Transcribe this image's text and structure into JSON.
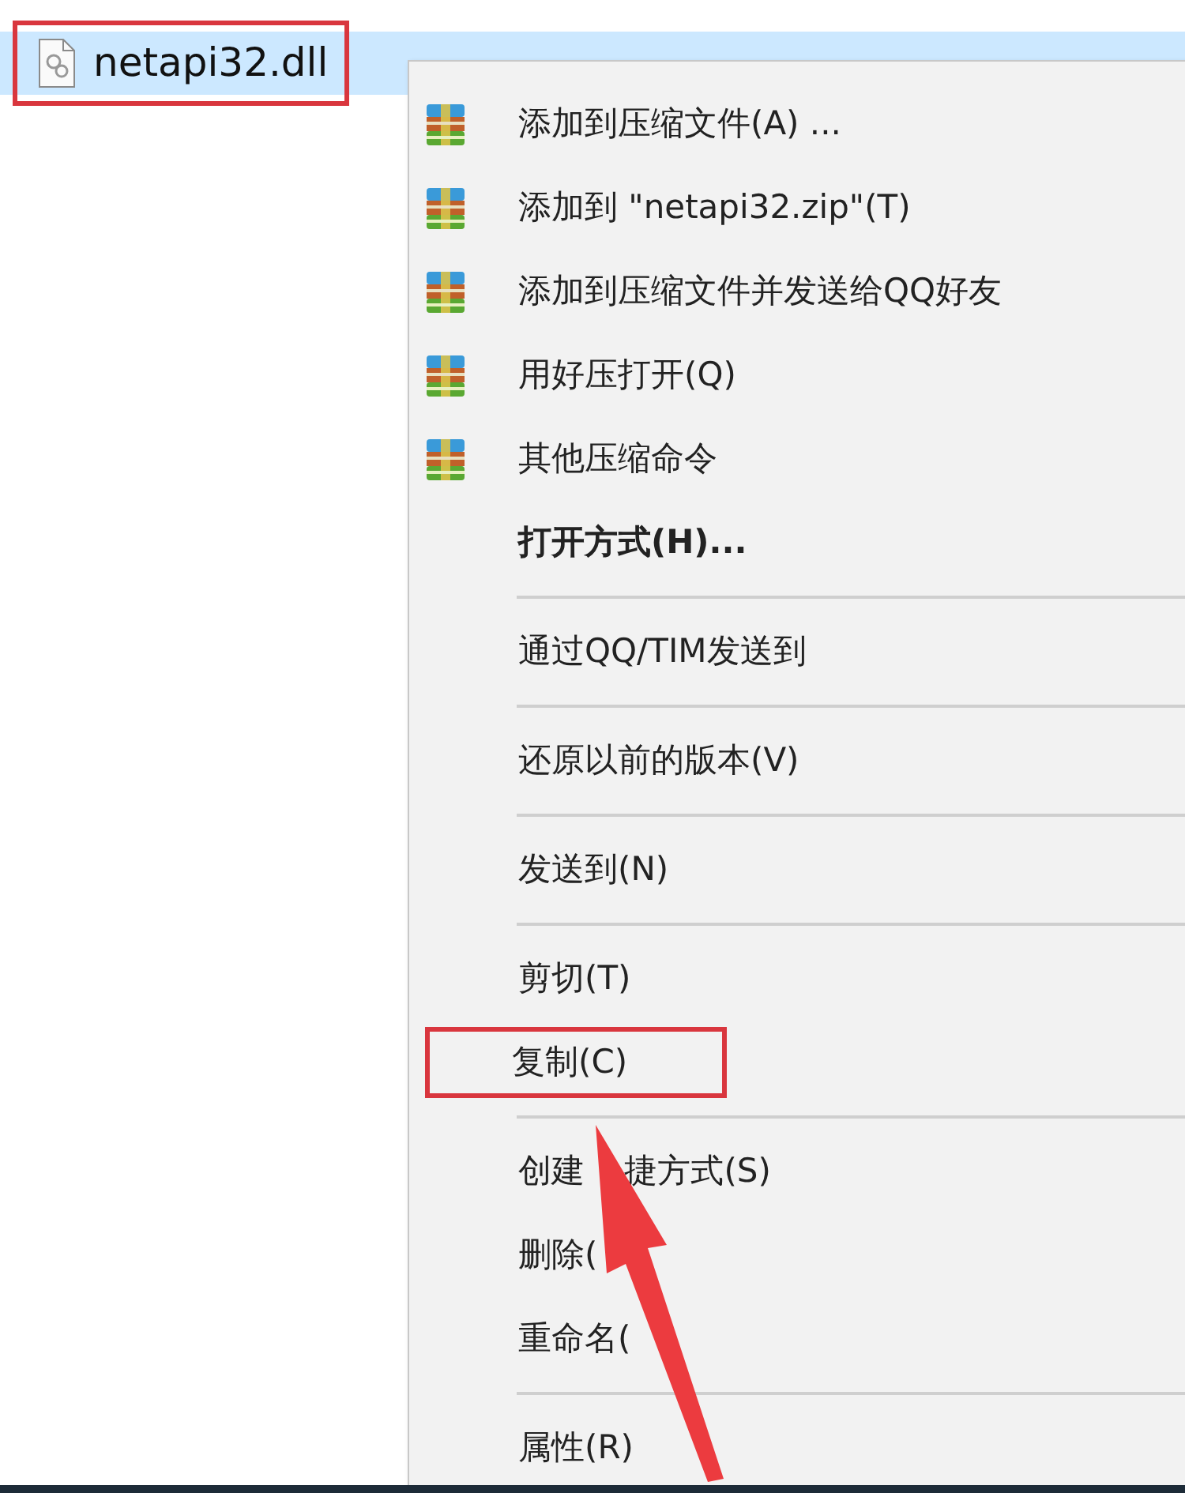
{
  "file": {
    "name": "netapi32.dll",
    "selected": true,
    "annotated": true
  },
  "context_menu": {
    "items": [
      {
        "kind": "item",
        "label": "添加到压缩文件(A) ...",
        "icon": true,
        "bold": false,
        "annotated": false
      },
      {
        "kind": "item",
        "label": "添加到 \"netapi32.zip\"(T)",
        "icon": true,
        "bold": false,
        "annotated": false
      },
      {
        "kind": "item",
        "label": "添加到压缩文件并发送给QQ好友",
        "icon": true,
        "bold": false,
        "annotated": false
      },
      {
        "kind": "item",
        "label": "用好压打开(Q)",
        "icon": true,
        "bold": false,
        "annotated": false
      },
      {
        "kind": "item",
        "label": "其他压缩命令",
        "icon": true,
        "bold": false,
        "annotated": false
      },
      {
        "kind": "item",
        "label": "打开方式(H)...",
        "icon": false,
        "bold": true,
        "annotated": false
      },
      {
        "kind": "separator"
      },
      {
        "kind": "item",
        "label": "通过QQ/TIM发送到",
        "icon": false,
        "bold": false,
        "annotated": false
      },
      {
        "kind": "separator"
      },
      {
        "kind": "item",
        "label": "还原以前的版本(V)",
        "icon": false,
        "bold": false,
        "annotated": false
      },
      {
        "kind": "separator"
      },
      {
        "kind": "item",
        "label": "发送到(N)",
        "icon": false,
        "bold": false,
        "annotated": false
      },
      {
        "kind": "separator"
      },
      {
        "kind": "item",
        "label": "剪切(T)",
        "icon": false,
        "bold": false,
        "annotated": false
      },
      {
        "kind": "item",
        "label": "复制(C)",
        "icon": false,
        "bold": false,
        "annotated": true
      },
      {
        "kind": "separator"
      },
      {
        "kind": "item",
        "label": "创建",
        "label_after_arrow": "捷方式(S)",
        "icon": false,
        "bold": false,
        "annotated": false
      },
      {
        "kind": "item",
        "label": "删除(",
        "icon": false,
        "bold": false,
        "annotated": false
      },
      {
        "kind": "item",
        "label": "重命名(",
        "icon": false,
        "bold": false,
        "annotated": false
      },
      {
        "kind": "separator"
      },
      {
        "kind": "item",
        "label": "属性(R)",
        "icon": false,
        "bold": false,
        "annotated": false
      }
    ]
  },
  "pointer_arrow": {
    "kind": "arrow"
  }
}
